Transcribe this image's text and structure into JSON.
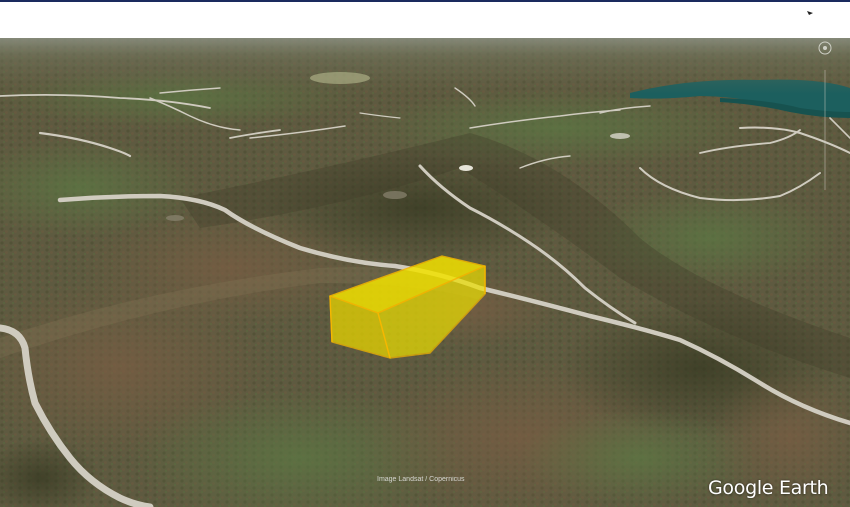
{
  "map": {
    "attribution": "Image Landsat / Copernicus",
    "brand": "Google Earth",
    "colors": {
      "forest": "#5d5a3e",
      "forest_dark": "#3f3f2c",
      "forest_green": "#4e6a3a",
      "road": "#cfcbbf",
      "water": "#1c5f5e",
      "sky_haze": "#a8aa9a",
      "building_fill": "#f2e200",
      "building_edge": "#f5b800"
    },
    "icons": [
      "compass-icon",
      "cursor-icon"
    ]
  }
}
